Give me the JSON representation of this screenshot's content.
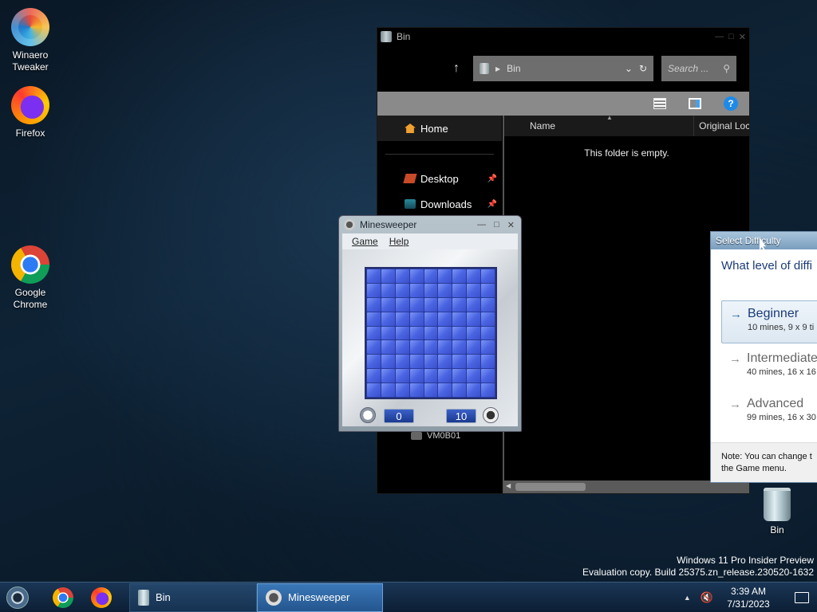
{
  "desktop": {
    "icons": [
      {
        "label": "Winaero\nTweaker",
        "icon": "winaero-tweaker-icon"
      },
      {
        "label": "Firefox",
        "icon": "firefox-icon"
      },
      {
        "label": "Google\nChrome",
        "icon": "chrome-icon"
      },
      {
        "label": "Bin",
        "icon": "recycle-bin-icon"
      }
    ]
  },
  "explorer": {
    "title": "Bin",
    "address": "Bin",
    "search_placeholder": "Search ...",
    "sidebar": {
      "home": "Home",
      "items": [
        {
          "label": "Desktop",
          "icon": "desktop-icon",
          "pinned": true
        },
        {
          "label": "Downloads",
          "icon": "downloads-icon",
          "pinned": true
        }
      ],
      "extra": "VM0B01"
    },
    "columns": {
      "name": "Name",
      "original_location": "Original Loc"
    },
    "empty_message": "This folder is empty."
  },
  "minesweeper": {
    "title": "Minesweeper",
    "menu": [
      "Game",
      "Help"
    ],
    "grid_size": 9,
    "time": "0",
    "mines": "10"
  },
  "difficulty_dialog": {
    "title": "Select Difficulty",
    "question": "What level of diffi",
    "options": [
      {
        "name": "Beginner",
        "desc": "10 mines, 9 x 9 ti",
        "selected": true
      },
      {
        "name": "Intermediate",
        "desc": "40 mines, 16 x 16",
        "selected": false
      },
      {
        "name": "Advanced",
        "desc": "99 mines, 16 x 30",
        "selected": false
      }
    ],
    "note_line1": "Note: You can change t",
    "note_line2": "the Game menu."
  },
  "watermark": {
    "line1": "Windows 11 Pro Insider Preview",
    "line2": "Evaluation copy. Build 25375.zn_release.230520-1632"
  },
  "taskbar": {
    "buttons": [
      {
        "label": "Bin",
        "active": false
      },
      {
        "label": "Minesweeper",
        "active": true
      }
    ],
    "time": "3:39 AM",
    "date": "7/31/2023"
  },
  "colors": {
    "tile_blue": "#4a64e2",
    "dialog_heading": "#1a3a78",
    "taskbar_active": "#3a78b8"
  }
}
